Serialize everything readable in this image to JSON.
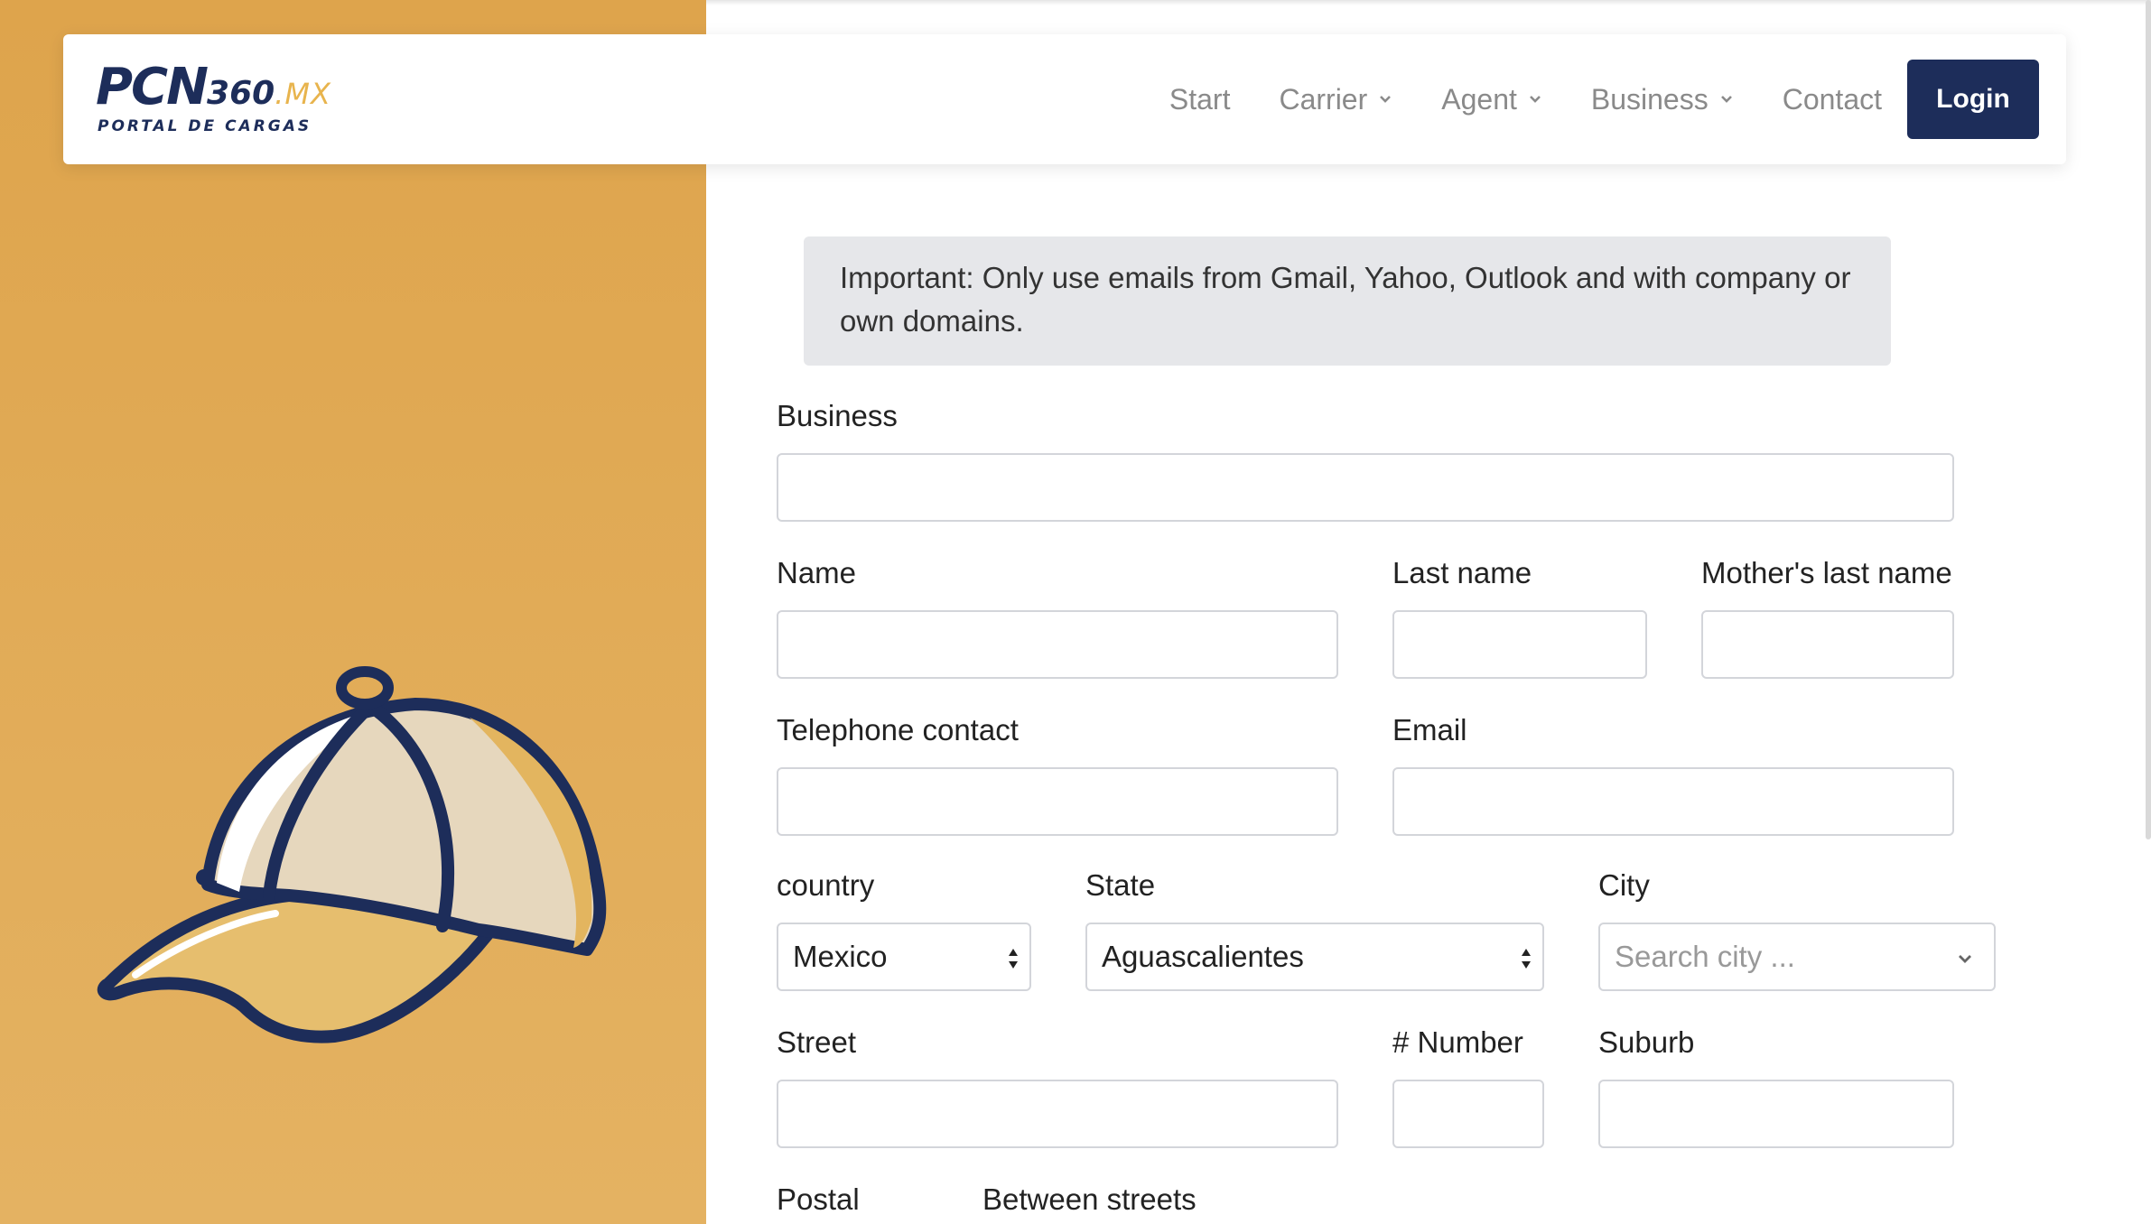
{
  "brand": {
    "logo_main": "PCN",
    "logo_num": "360",
    "logo_mx": ".MX",
    "logo_sub": "PORTAL DE CARGAS",
    "colors": {
      "navy": "#1d2d5a",
      "gold": "#e8b44d",
      "panel": "#dea44c"
    }
  },
  "nav": {
    "items": [
      {
        "label": "Start"
      },
      {
        "label": "Carrier"
      },
      {
        "label": "Agent"
      },
      {
        "label": "Business"
      },
      {
        "label": "Contact"
      }
    ],
    "login_label": "Login"
  },
  "notice": "Important: Only use emails from Gmail, Yahoo, Outlook and with company or own domains.",
  "form": {
    "business_label": "Business",
    "name_label": "Name",
    "last_name_label": "Last name",
    "mothers_last_name_label": "Mother's last name",
    "telephone_label": "Telephone contact",
    "email_label": "Email",
    "country_label": "country",
    "country_value": "Mexico",
    "state_label": "State",
    "state_value": "Aguascalientes",
    "city_label": "City",
    "city_placeholder": "Search city ...",
    "street_label": "Street",
    "number_label": "# Number",
    "suburb_label": "Suburb",
    "postal_label": "Postal",
    "between_streets_label": "Between streets"
  },
  "illustration": "baseball-cap-icon"
}
